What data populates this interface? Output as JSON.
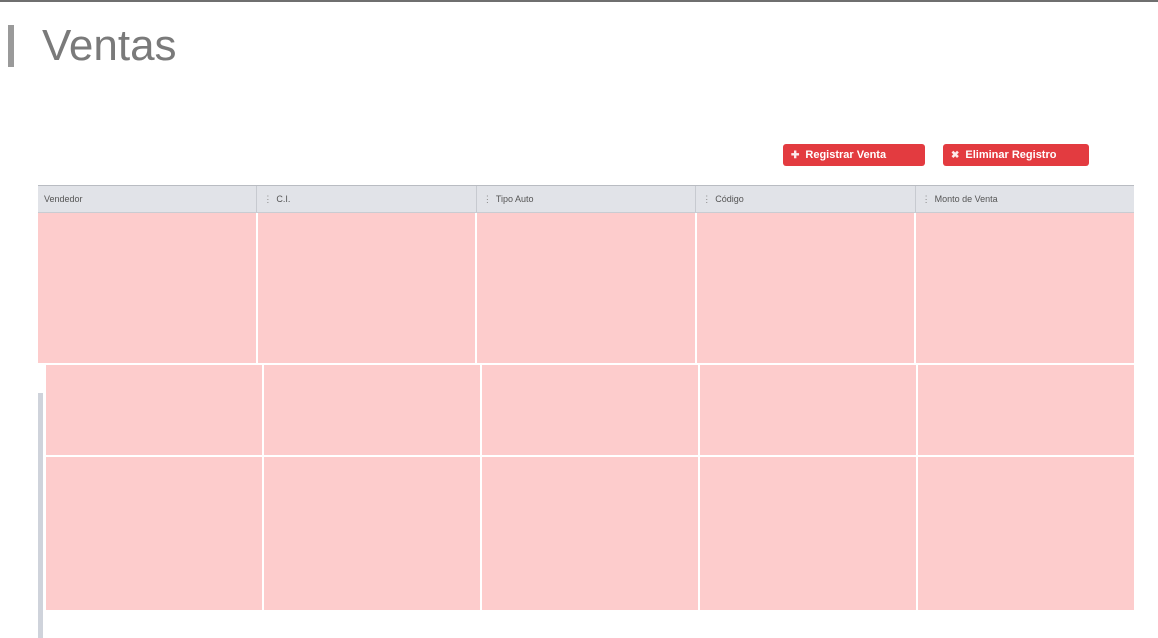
{
  "page": {
    "title": "Ventas"
  },
  "actions": {
    "register_label": "Registrar Venta",
    "delete_label": "Eliminar Registro",
    "register_icon": "plus-icon",
    "delete_icon": "trash-icon"
  },
  "table": {
    "columns": [
      {
        "label": "Vendedor"
      },
      {
        "label": "C.I."
      },
      {
        "label": "Tipo Auto"
      },
      {
        "label": "Código"
      },
      {
        "label": "Monto de Venta"
      }
    ],
    "rows": [
      [
        "",
        "",
        "",
        "",
        ""
      ],
      [
        "",
        "",
        "",
        "",
        ""
      ],
      [
        "",
        "",
        "",
        "",
        ""
      ]
    ]
  },
  "colors": {
    "accent": "#e33b40",
    "row_fill": "#fdcccc",
    "header_bg": "#e1e3e8"
  }
}
